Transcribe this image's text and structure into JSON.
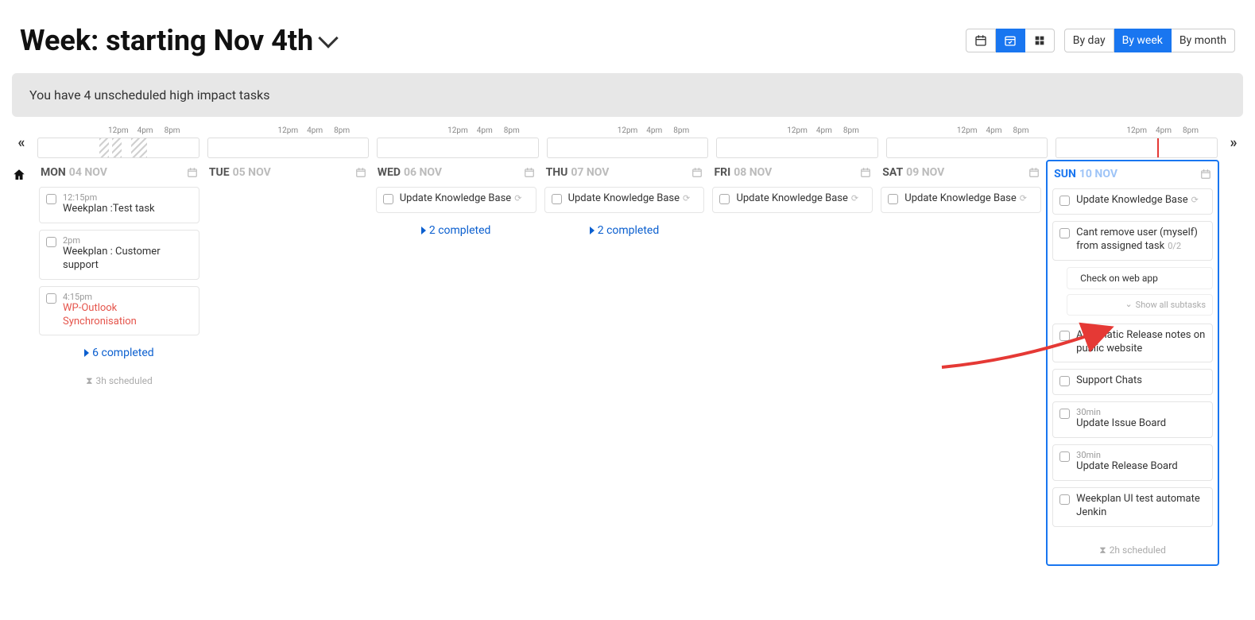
{
  "header": {
    "title": "Week: starting Nov 4th"
  },
  "range_switch": {
    "by_day": "By day",
    "by_week": "By week",
    "by_month": "By month"
  },
  "banner": "You have 4 unscheduled high impact tasks",
  "time_labels": {
    "t1": "12pm",
    "t2": "4pm",
    "t3": "8pm"
  },
  "days": [
    {
      "dow": "MON",
      "date": "04 NOV",
      "tasks": [
        {
          "time": "12:15pm",
          "title": "Weekplan :Test task"
        },
        {
          "time": "2pm",
          "title": "Weekplan : Customer support"
        },
        {
          "time": "4:15pm",
          "title": "WP-Outlook Synchronisation",
          "danger": true
        }
      ],
      "completed": "6 completed",
      "scheduled": "3h scheduled"
    },
    {
      "dow": "TUE",
      "date": "05 NOV"
    },
    {
      "dow": "WED",
      "date": "06 NOV",
      "tasks": [
        {
          "title": "Update Knowledge Base",
          "refresh": true
        }
      ],
      "completed": "2 completed"
    },
    {
      "dow": "THU",
      "date": "07 NOV",
      "tasks": [
        {
          "title": "Update Knowledge Base",
          "refresh": true
        }
      ],
      "completed": "2 completed"
    },
    {
      "dow": "FRI",
      "date": "08 NOV",
      "tasks": [
        {
          "title": "Update Knowledge Base",
          "refresh": true
        }
      ]
    },
    {
      "dow": "SAT",
      "date": "09 NOV",
      "tasks": [
        {
          "title": "Update Knowledge Base",
          "refresh": true
        }
      ]
    },
    {
      "dow": "SUN",
      "date": "10 NOV",
      "today": true,
      "tasks": [
        {
          "title": "Update Knowledge Base",
          "refresh": true
        },
        {
          "title": "Cant remove user (myself) from assigned task",
          "meta": "0/2",
          "subtasks": [
            {
              "title": "Check on web app"
            }
          ],
          "show_all": "Show all subtasks"
        },
        {
          "title": "Automatic Release notes on public website"
        },
        {
          "title": "Support Chats"
        },
        {
          "time": "30min",
          "title": "Update Issue Board"
        },
        {
          "time": "30min",
          "title": "Update Release Board"
        },
        {
          "title": "Weekplan UI test automate Jenkin"
        }
      ],
      "scheduled": "2h scheduled"
    }
  ]
}
